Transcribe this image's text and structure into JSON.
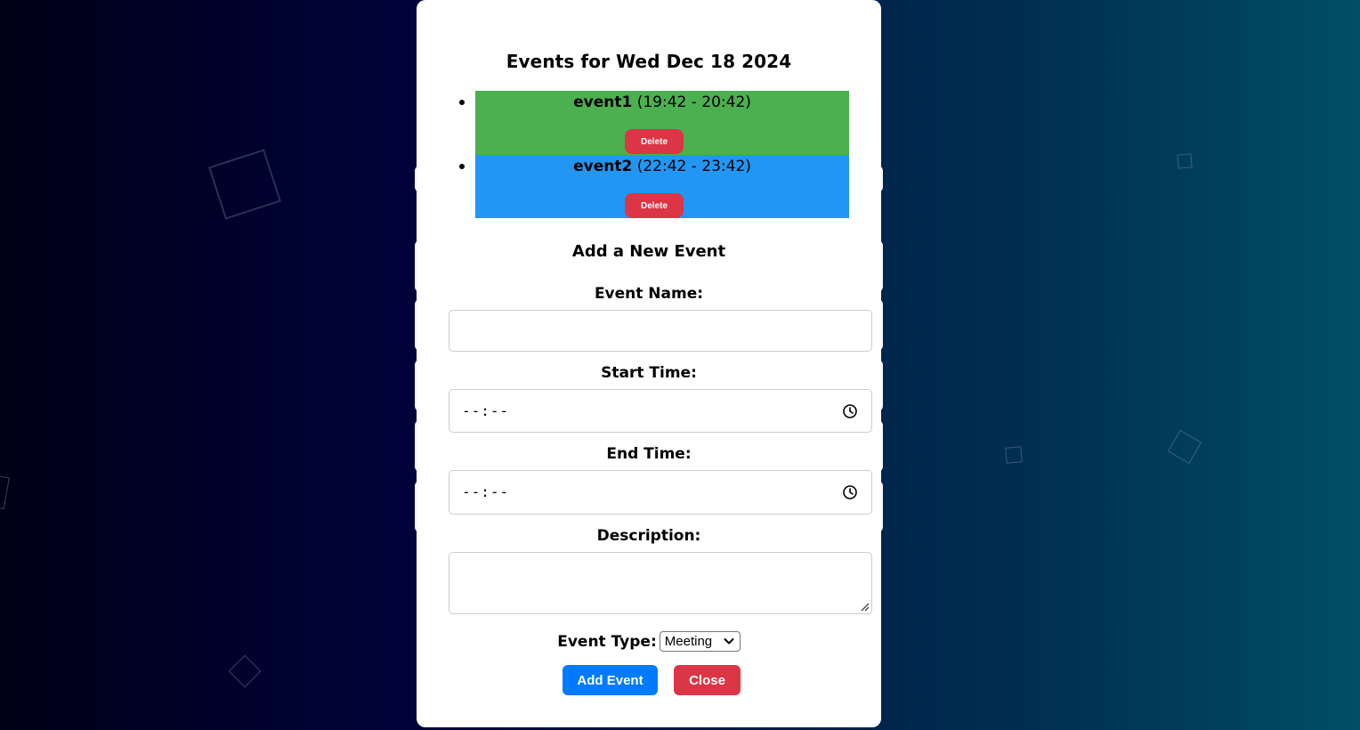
{
  "modal": {
    "title": "Events for Wed Dec 18 2024"
  },
  "events": [
    {
      "name": "event1",
      "time": "(19:42 - 20:42)",
      "delete_label": "Delete",
      "color": "#4caf50"
    },
    {
      "name": "event2",
      "time": "(22:42 - 23:42)",
      "delete_label": "Delete",
      "color": "#2196f3"
    }
  ],
  "form": {
    "heading": "Add a New Event",
    "event_name_label": "Event Name:",
    "event_name_value": "",
    "start_time_label": "Start Time:",
    "start_time_value": "--:--",
    "end_time_label": "End Time:",
    "end_time_value": "--:--",
    "description_label": "Description:",
    "description_value": "",
    "event_type_label": "Event Type:",
    "event_type_value": "Meeting",
    "add_label": "Add Event",
    "close_label": "Close"
  },
  "colors": {
    "primary": "#007bff",
    "danger": "#dc3545"
  },
  "icons": {
    "time_picker": "clock-icon",
    "select": "chevron-down-icon",
    "textarea": "resize-handle-icon"
  }
}
